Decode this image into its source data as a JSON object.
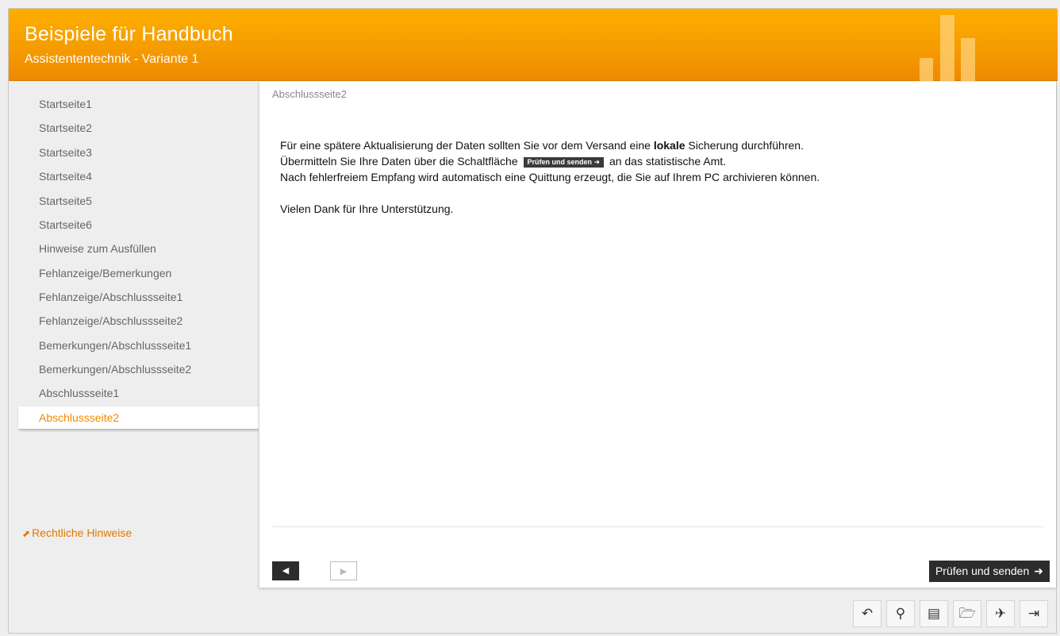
{
  "header": {
    "title": "Beispiele für Handbuch",
    "subtitle": "Assistententechnik - Variante 1"
  },
  "sidebar": {
    "items": [
      {
        "label": "Startseite1"
      },
      {
        "label": "Startseite2"
      },
      {
        "label": "Startseite3"
      },
      {
        "label": "Startseite4"
      },
      {
        "label": "Startseite5"
      },
      {
        "label": "Startseite6"
      },
      {
        "label": "Hinweise zum Ausfüllen"
      },
      {
        "label": "Fehlanzeige/Bemerkungen"
      },
      {
        "label": "Fehlanzeige/Abschlussseite1"
      },
      {
        "label": "Fehlanzeige/Abschlussseite2"
      },
      {
        "label": "Bemerkungen/Abschlussseite1"
      },
      {
        "label": "Bemerkungen/Abschlussseite2"
      },
      {
        "label": "Abschlussseite1"
      },
      {
        "label": "Abschlussseite2"
      }
    ],
    "active": "Abschlussseite2",
    "legal_link": "Rechtliche Hinweise",
    "legal_icon": "external-link-icon",
    "collapse_glyph": "‹"
  },
  "content": {
    "page_title": "Abschlussseite2",
    "line1_pre": "Für eine spätere Aktualisierung der Daten sollten Sie vor dem Versand eine ",
    "line1_bold": "lokale",
    "line1_post": " Sicherung durchführen.",
    "line2_pre": "Übermitteln Sie Ihre Daten über die Schaltfläche",
    "line2_inline_button": "Prüfen und senden ➜",
    "line2_post": "an das statistische Amt.",
    "line3": "Nach fehlerfreiem Empfang wird automatisch eine Quittung erzeugt, die Sie auf Ihrem PC archivieren können.",
    "thanks": "Vielen Dank für Ihre Unterstützung."
  },
  "navigation": {
    "prev_glyph": "◀",
    "next_glyph": "▶",
    "submit_label": "Prüfen und senden",
    "submit_arrow": "➜"
  },
  "toolbar": [
    {
      "icon": "undo-icon",
      "glyph": "↶"
    },
    {
      "icon": "search-icon",
      "glyph": "⚲"
    },
    {
      "icon": "save-icon",
      "glyph": "▤"
    },
    {
      "icon": "open-folder-icon",
      "glyph": "🗁"
    },
    {
      "icon": "send-icon",
      "glyph": "✈"
    },
    {
      "icon": "exit-icon",
      "glyph": "⇥"
    }
  ],
  "colors": {
    "header": "#f59c00",
    "accent": "#f08a00",
    "button_dark": "#2c2c2c"
  }
}
